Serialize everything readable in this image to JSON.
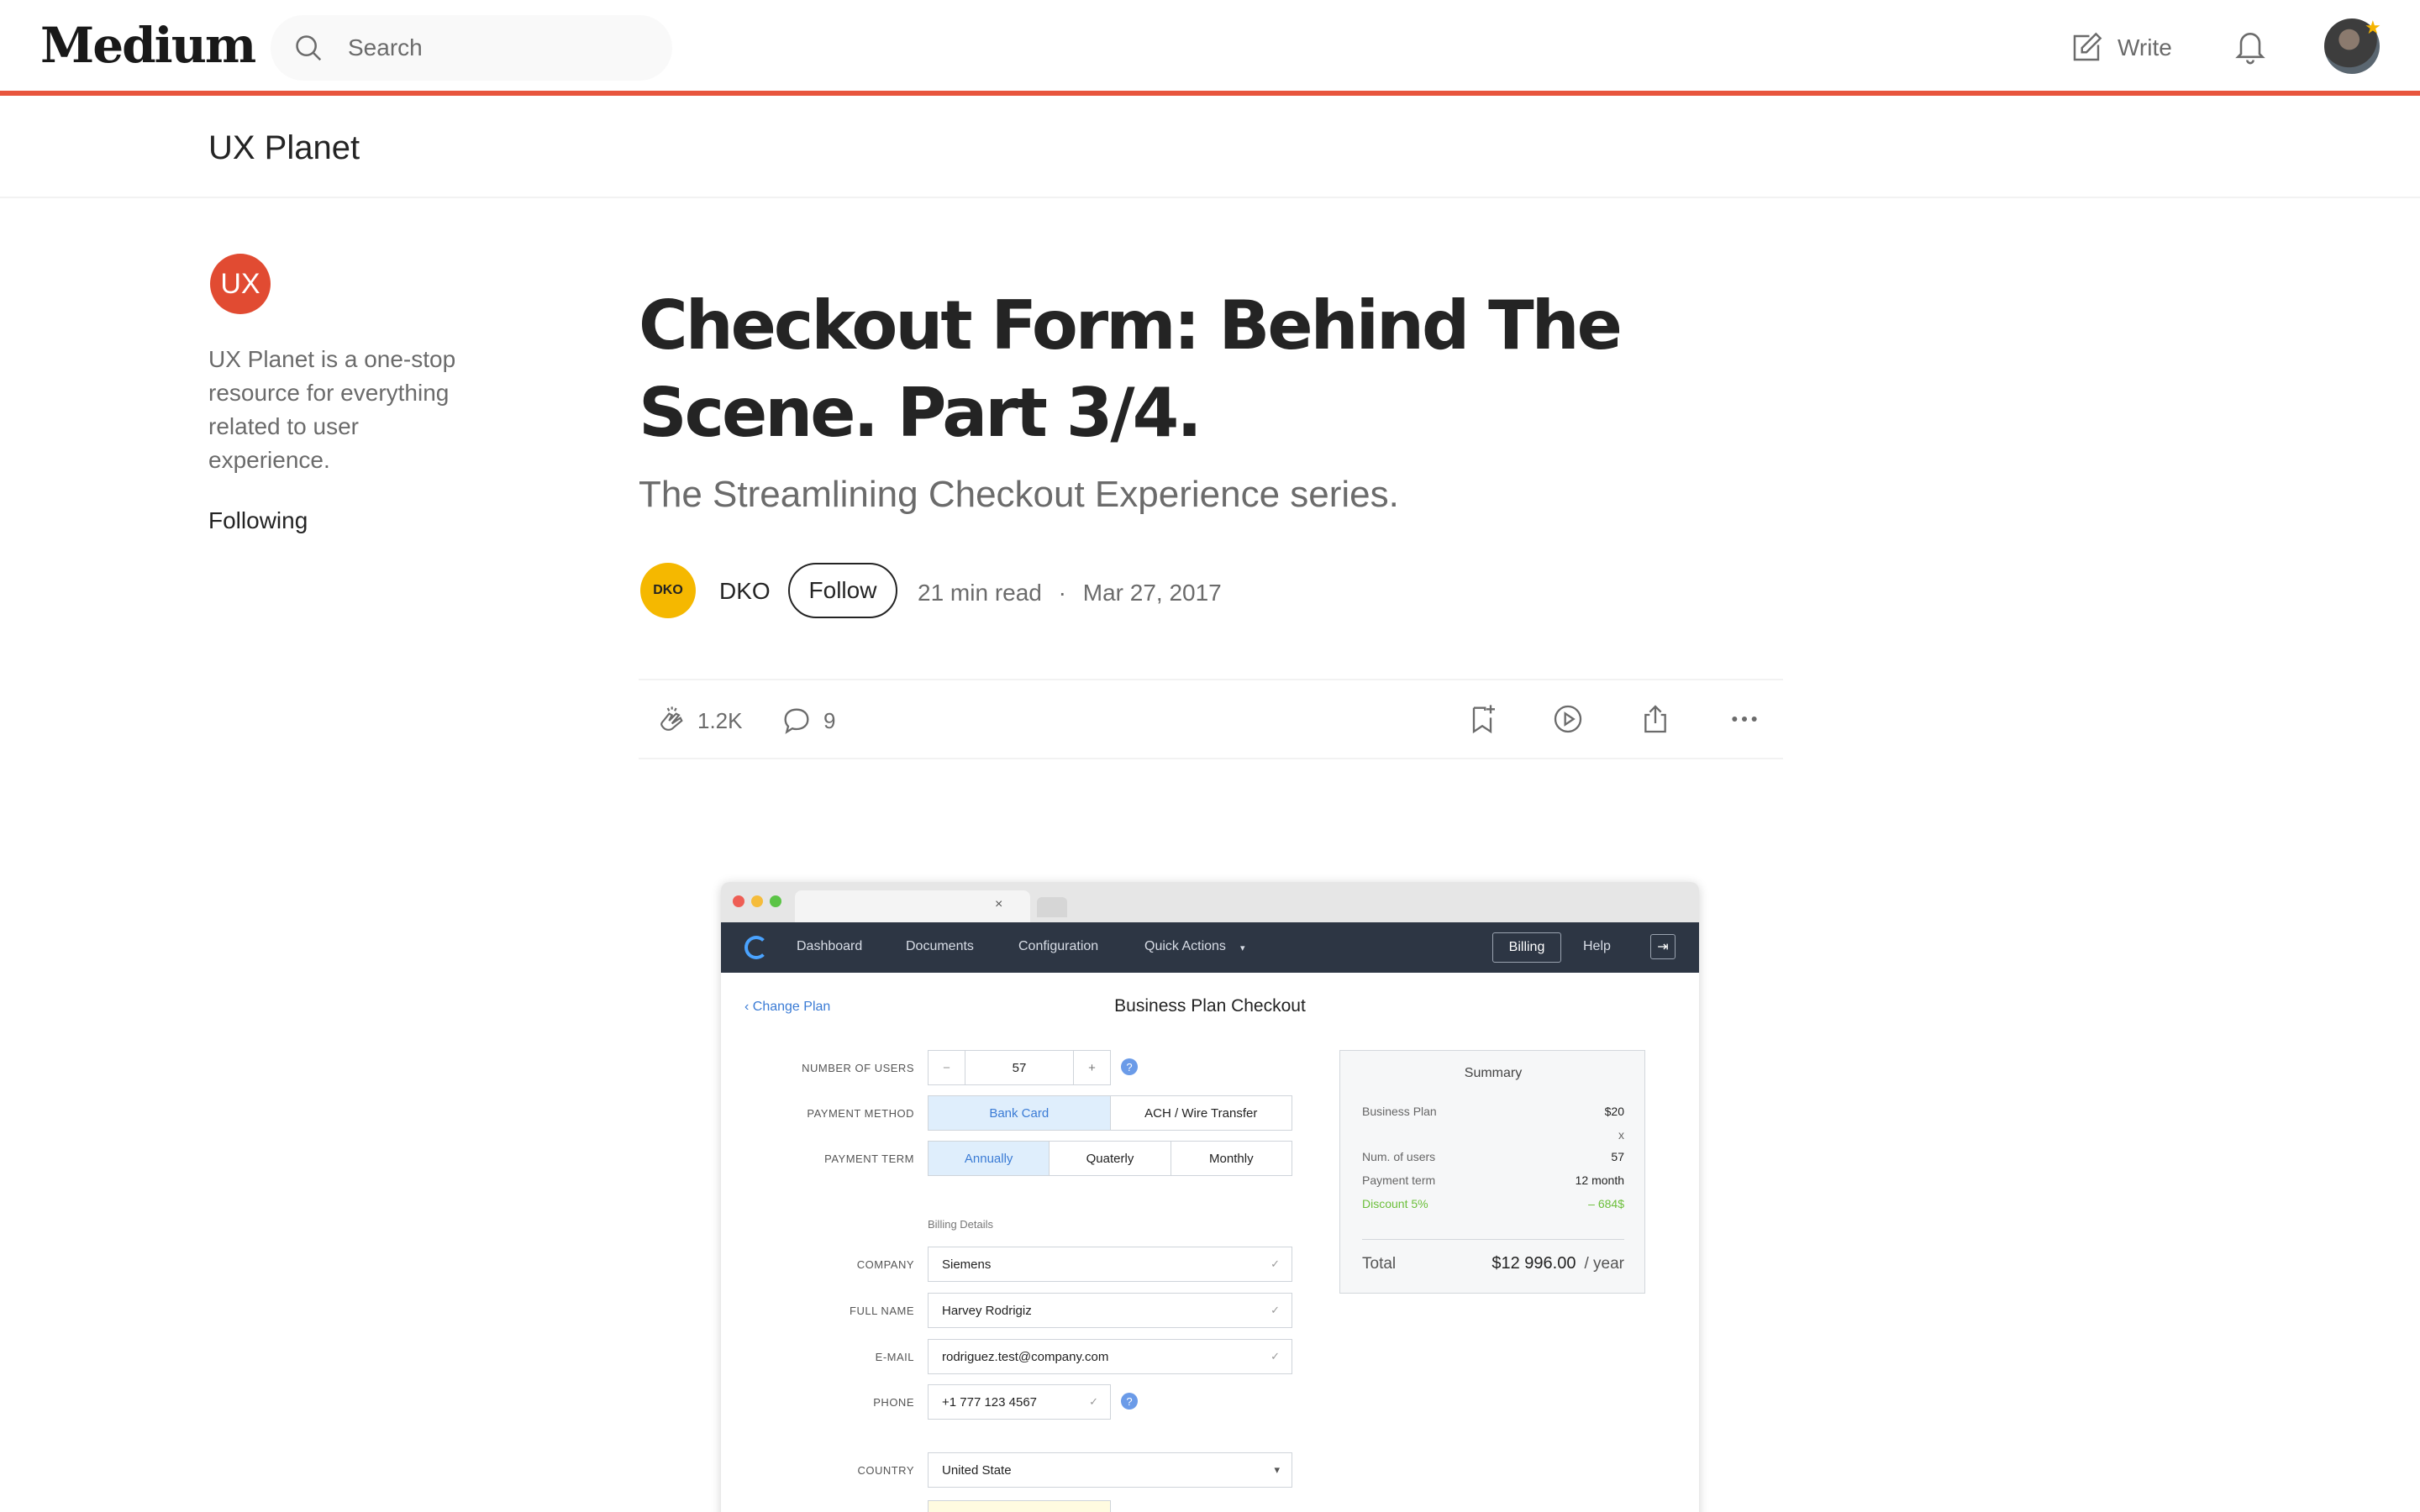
{
  "topnav": {
    "logo": "Medium",
    "search_placeholder": "Search",
    "write_label": "Write"
  },
  "publication": {
    "name": "UX Planet",
    "logo_text": "UX",
    "description": "UX Planet is a one-stop resource for everything related to user experience.",
    "following_label": "Following"
  },
  "article": {
    "title": "Checkout Form: Behind The Scene. Part 3/4.",
    "subtitle": "The Streamlining Checkout Experience series.",
    "author": {
      "name": "DKO",
      "avatar_text": "DKO",
      "follow_label": "Follow"
    },
    "read_time": "21 min read",
    "separator": "·",
    "date": "Mar 27, 2017"
  },
  "actions": {
    "claps": "1.2K",
    "responses": "9"
  },
  "embedded_screenshot": {
    "nav": [
      "Dashboard",
      "Documents",
      "Configuration",
      "Quick Actions"
    ],
    "billing_label": "Billing",
    "help_label": "Help",
    "change_plan": "Change Plan",
    "title": "Business Plan Checkout",
    "labels": {
      "users": "NUMBER OF USERS",
      "payment_method": "PAYMENT METHOD",
      "payment_term": "PAYMENT TERM",
      "company": "COMPANY",
      "full_name": "FULL NAME",
      "email": "E-MAIL",
      "phone": "PHONE",
      "country": "COUNTRY"
    },
    "users_minus": "−",
    "users_value": "57",
    "users_plus": "+",
    "payment_methods": [
      "Bank Card",
      "ACH / Wire Transfer"
    ],
    "payment_terms": [
      "Annually",
      "Quaterly",
      "Monthly"
    ],
    "billing_details_label": "Billing Details",
    "company": "Siemens",
    "full_name": "Harvey Rodrigiz",
    "email": "rodriguez.test@company.com",
    "phone": "+1 777 123 4567",
    "country": "United State",
    "summary": {
      "title": "Summary",
      "plan_label": "Business Plan",
      "plan_price": "$20",
      "times": "x",
      "users_label": "Num. of users",
      "users_value": "57",
      "term_label": "Payment term",
      "term_value": "12 month",
      "discount_label": "Discount 5%",
      "discount_value": "– 684$",
      "total_label": "Total",
      "total_value": "$12 996.00",
      "per": "/ year"
    }
  }
}
